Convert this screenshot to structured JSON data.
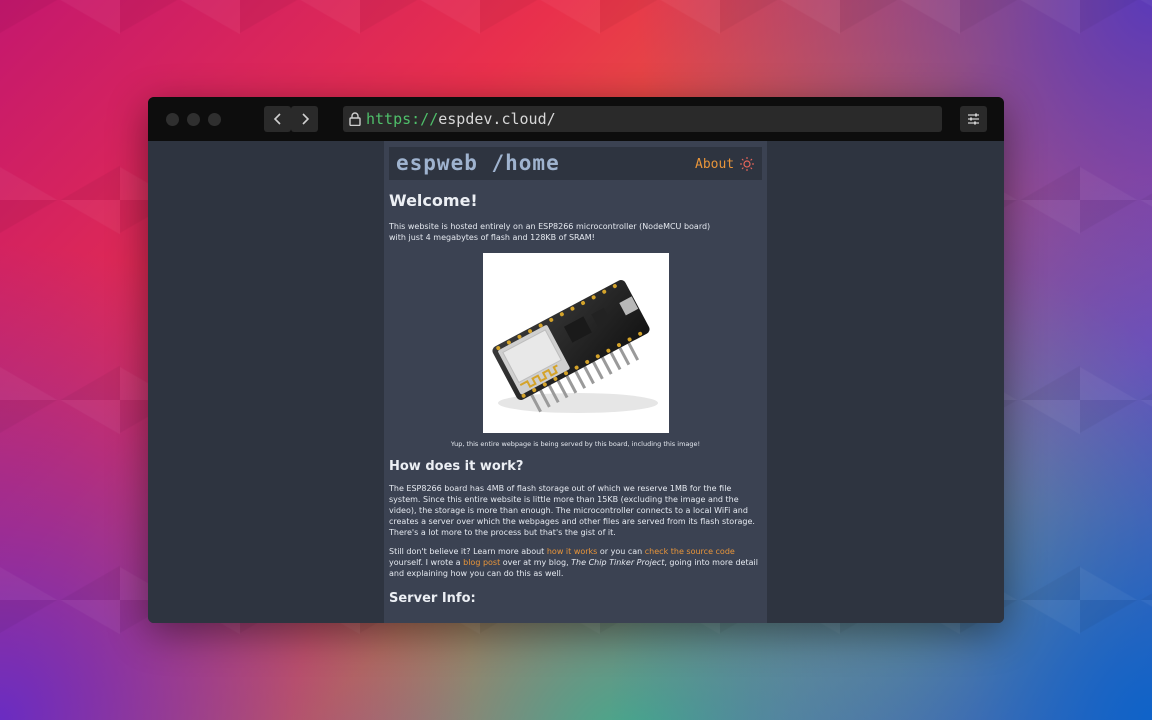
{
  "browser": {
    "url_scheme": "https://",
    "url_host": "espdev.cloud/"
  },
  "site": {
    "logo": "espweb /home",
    "nav_about": "About"
  },
  "page": {
    "welcome_title": "Welcome!",
    "intro": "This website is hosted entirely on an ESP8266 microcontroller (NodeMCU board) with just 4 megabytes of flash and 128KB of SRAM!",
    "image_caption": "Yup, this entire webpage is being served by this board, including this image!",
    "how_title": "How does it work?",
    "how_text": "The ESP8266 board has 4MB of flash storage out of which we reserve 1MB for the file system. Since this entire website is little more than 15KB (excluding the image and the video), the storage is more than enough. The microcontroller connects to a local WiFi and creates a server over which the webpages and other files are served from its flash storage. There's a lot more to the process but that's the gist of it.",
    "believe_1": "Still don't believe it? Learn more about ",
    "link_how": "how it works",
    "believe_2": " or you can ",
    "link_source": "check the source code",
    "believe_3": " yourself. I wrote a ",
    "link_blog": "blog post",
    "believe_4": " over at my blog, ",
    "blog_name": "The Chip Tinker Project",
    "believe_5": ", going into more detail and explaining how you can do this as well.",
    "server_title": "Server Info:"
  },
  "colors": {
    "accent": "#e8953a",
    "url_scheme": "#4fbf6a",
    "page_bg": "#2e3440",
    "content_bg": "#3b4252"
  }
}
